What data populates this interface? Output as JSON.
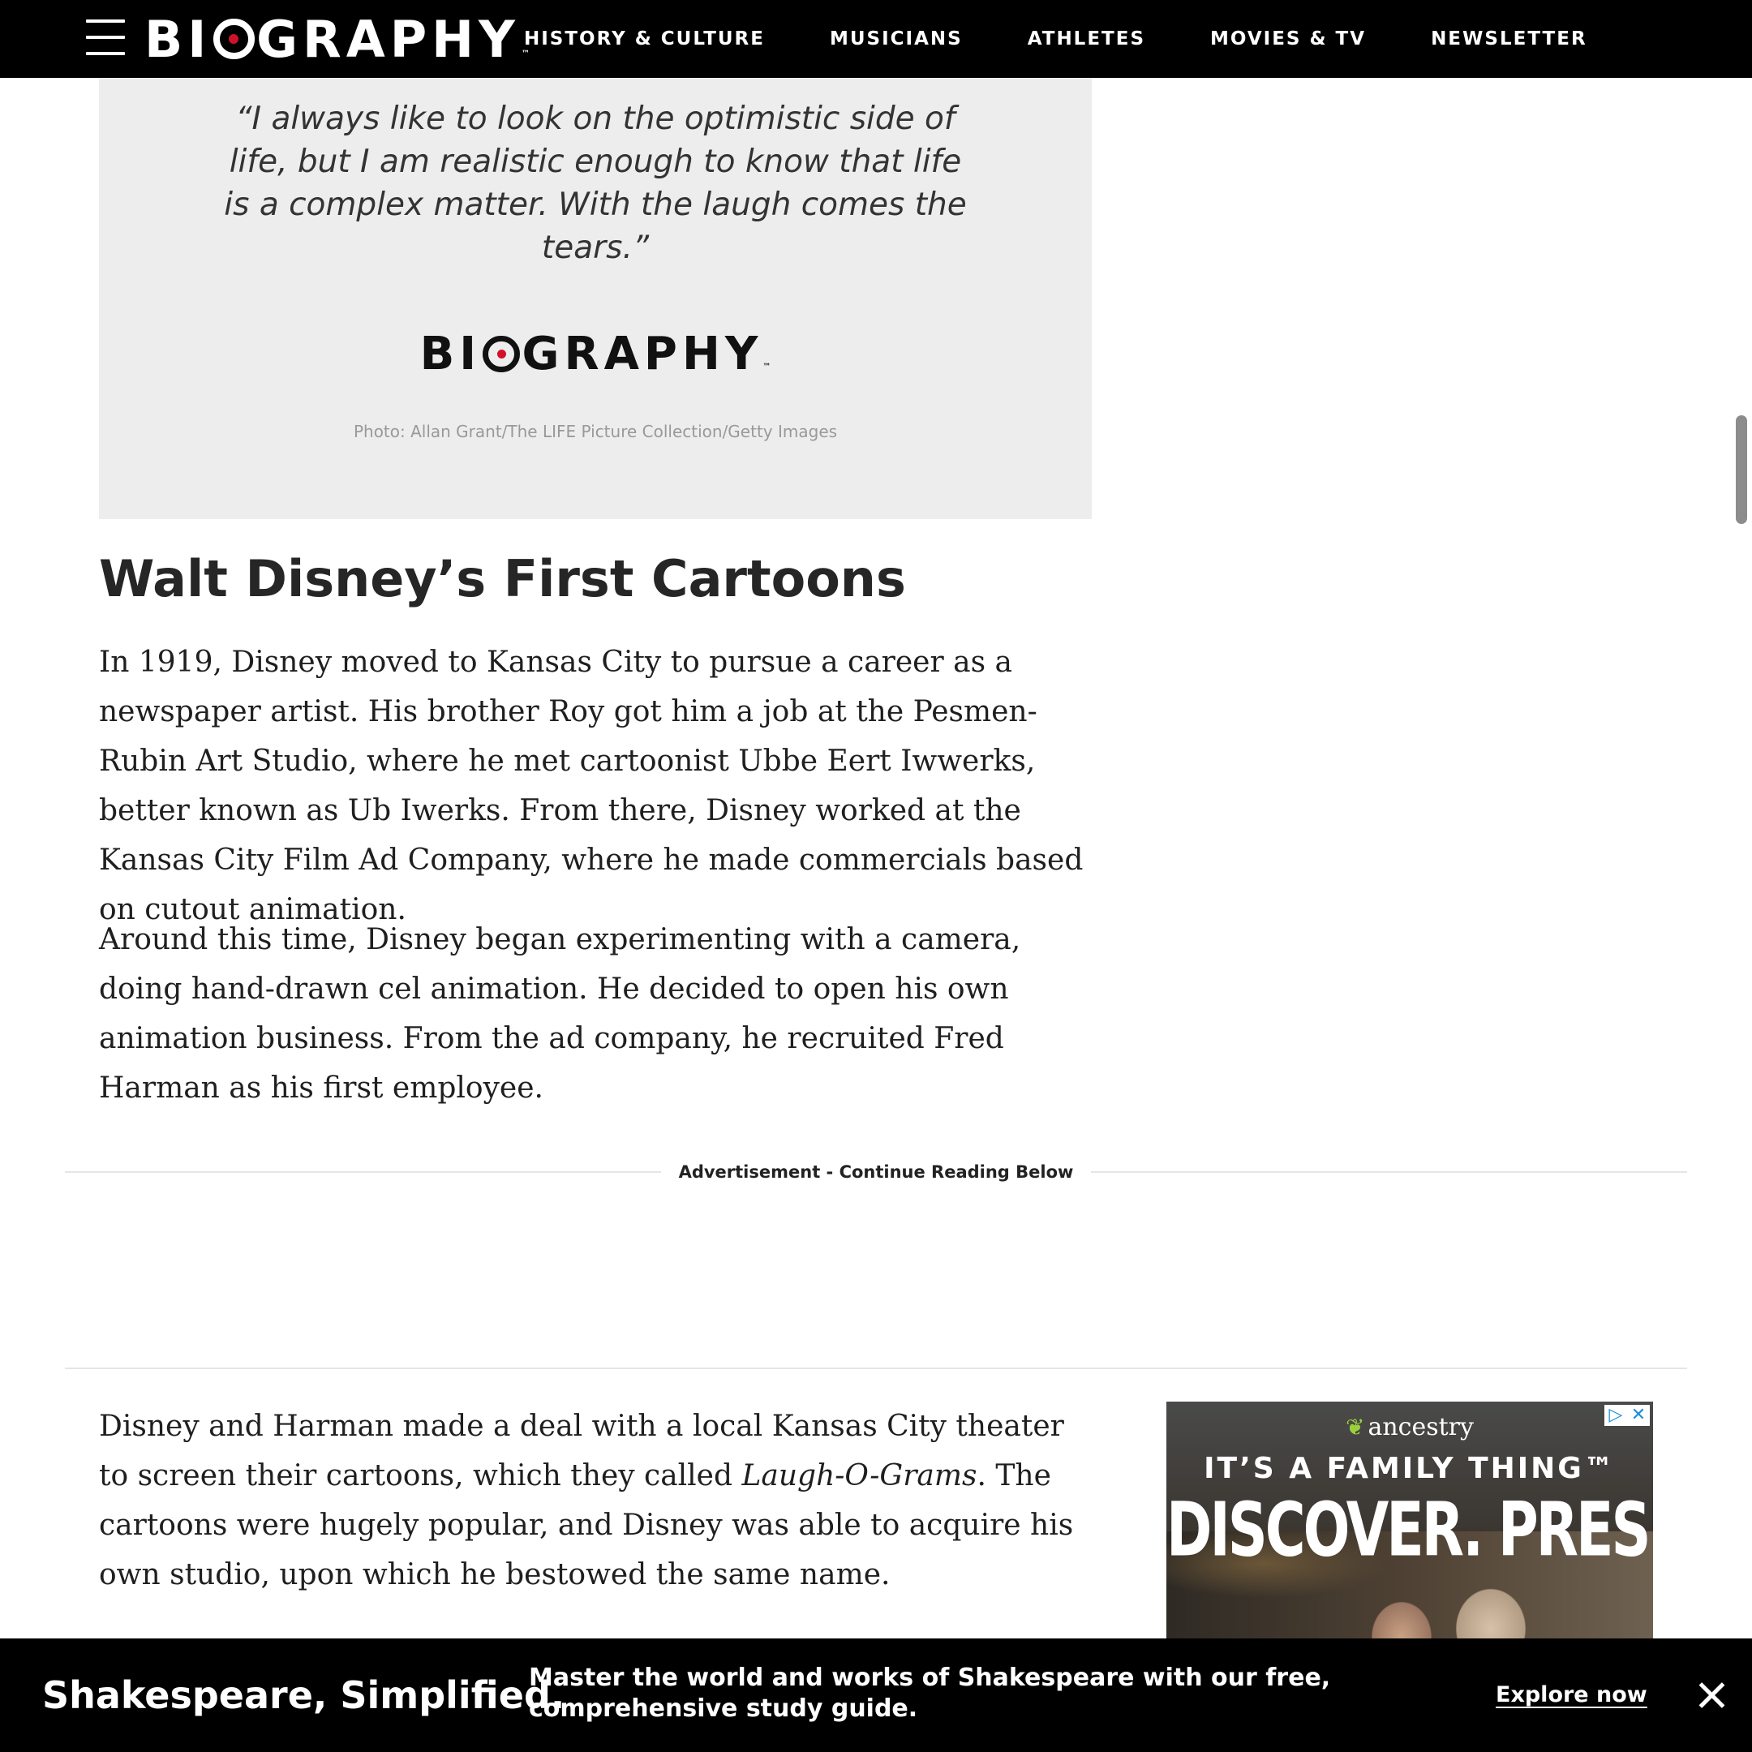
{
  "header": {
    "logo_text": "BIOGRAPHY",
    "nav": [
      {
        "label": "HISTORY & CULTURE"
      },
      {
        "label": "MUSICIANS"
      },
      {
        "label": "ATHLETES"
      },
      {
        "label": "MOVIES & TV"
      },
      {
        "label": "NEWSLETTER"
      }
    ],
    "menu_icon": "hamburger-menu-icon"
  },
  "quote_card": {
    "quote": "“I always like to look on the optimistic side of life, but I am realistic enough to know that life is a complex matter. With the laugh comes the tears.”",
    "brand": "BIOGRAPHY",
    "credit": "Photo: Allan Grant/The LIFE Picture Collection/Getty Images"
  },
  "article": {
    "heading": "Walt Disney’s First Cartoons",
    "paragraph_1": "In 1919, Disney moved to Kansas City to pursue a career as a newspaper artist. His brother Roy got him a job at the Pesmen-Rubin Art Studio, where he met cartoonist Ubbe Eert Iwwerks, better known as Ub Iwerks. From there, Disney worked at the Kansas City Film Ad Company, where he made commercials based on cutout animation.",
    "paragraph_2": "Around this time, Disney began experimenting with a camera, doing hand-drawn cel animation. He decided to open his own animation business. From the ad company, he recruited Fred Harman as his first employee.",
    "paragraph_3_before": "Disney and Harman made a deal with a local Kansas City theater to screen their cartoons, which they called ",
    "paragraph_3_italic": "Laugh-O-Grams",
    "paragraph_3_after": ". The cartoons were hugely popular, and Disney was able to acquire his own studio, upon which he bestowed the same name."
  },
  "ad_separator": {
    "label": "Advertisement - Continue Reading Below"
  },
  "side_ad": {
    "brand": "ancestry",
    "line1": "IT’S A FAMILY THING™",
    "line2": "DISCOVER. PRESERVE. SHARE.",
    "choices_icon": "▷",
    "close_icon": "✕"
  },
  "promo_bar": {
    "title": "Shakespeare, Simplified.",
    "description": "Master the world and works of Shakespeare with our free, comprehensive study guide.",
    "cta": "Explore now"
  },
  "colors": {
    "accent_red": "#d0112b",
    "nav_bg": "#000000",
    "card_bg": "#ededed"
  }
}
